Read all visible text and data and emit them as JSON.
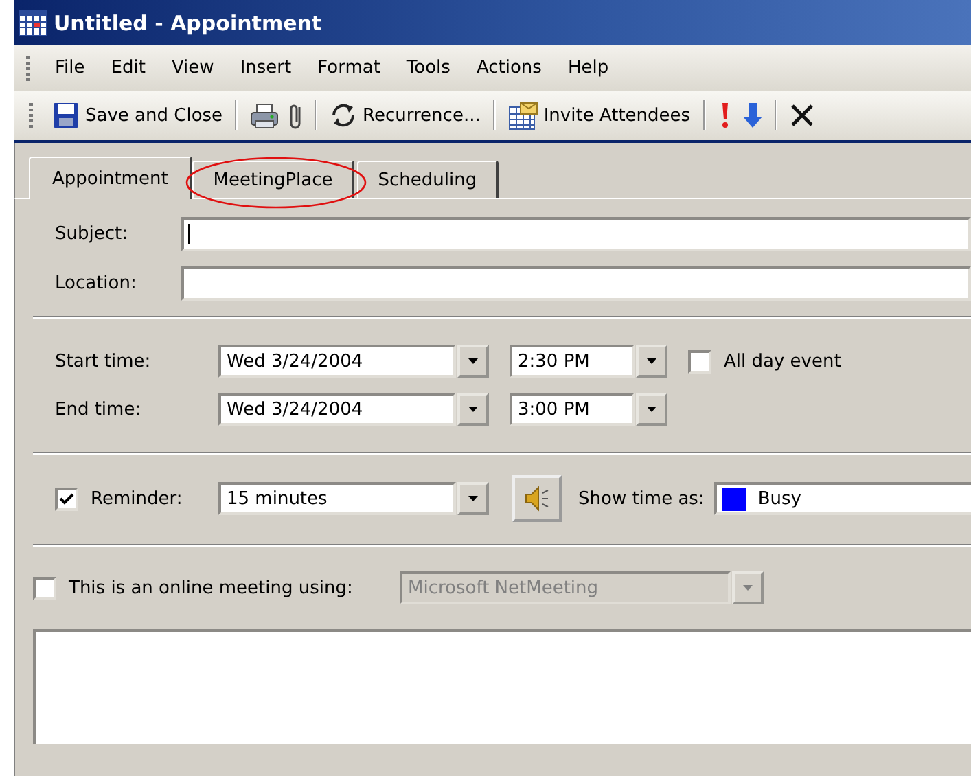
{
  "window": {
    "title": "Untitled - Appointment"
  },
  "menu": [
    {
      "label": "File"
    },
    {
      "label": "Edit"
    },
    {
      "label": "View"
    },
    {
      "label": "Insert"
    },
    {
      "label": "Format"
    },
    {
      "label": "Tools"
    },
    {
      "label": "Actions"
    },
    {
      "label": "Help"
    }
  ],
  "toolbar": [
    {
      "kind": "save",
      "label": "Save and Close"
    },
    {
      "kind": "separator"
    },
    {
      "kind": "print"
    },
    {
      "kind": "attach"
    },
    {
      "kind": "separator"
    },
    {
      "kind": "recurrence",
      "label": "Recurrence..."
    },
    {
      "kind": "separator"
    },
    {
      "kind": "invite",
      "label": "Invite Attendees"
    },
    {
      "kind": "separator"
    },
    {
      "kind": "high"
    },
    {
      "kind": "low"
    },
    {
      "kind": "separator"
    },
    {
      "kind": "delete"
    }
  ],
  "tabs": [
    {
      "label": "Appointment",
      "selected": true,
      "circled": false
    },
    {
      "label": "MeetingPlace",
      "selected": false,
      "circled": true
    },
    {
      "label": "Scheduling",
      "selected": false,
      "circled": false
    }
  ],
  "subject": {
    "label": "Subject:",
    "focused": true
  },
  "location": {
    "label": "Location:",
    "focused": false
  },
  "start": {
    "label": "Start time:",
    "date": "Wed 3/24/2004",
    "time": "2:30 PM"
  },
  "all_day": {
    "label": "All day event",
    "checked": false
  },
  "end": {
    "label": "End time:",
    "date": "Wed 3/24/2004",
    "time": "3:00 PM"
  },
  "reminder": {
    "label": "Reminder:",
    "checked": true,
    "value": "15 minutes"
  },
  "show_time_as": {
    "label": "Show time as:",
    "value": "Busy",
    "color": "#0000ff"
  },
  "online": {
    "label": "This is an online meeting using:",
    "checked": false,
    "value": "Microsoft NetMeeting",
    "disabled": true
  }
}
